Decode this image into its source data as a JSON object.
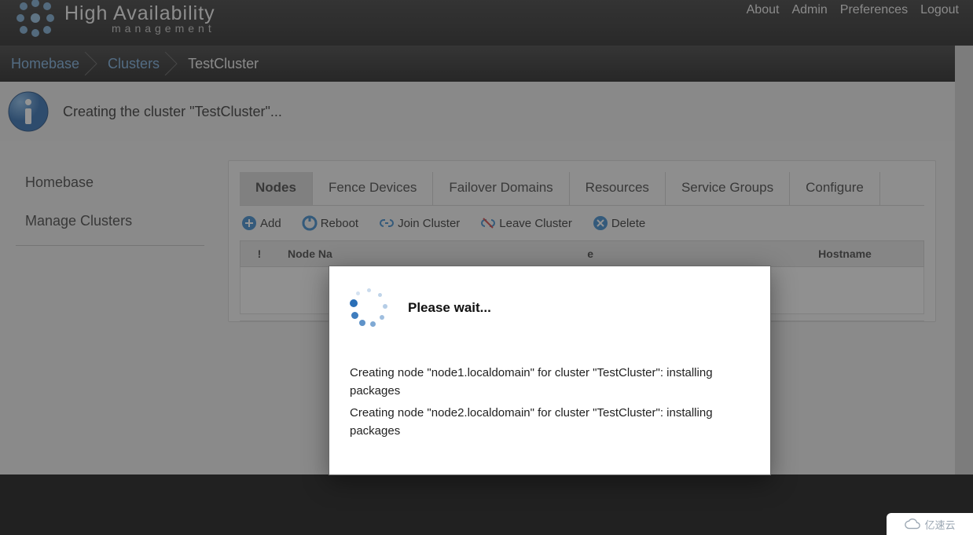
{
  "header": {
    "title_main": "High Availability",
    "title_sub": "management",
    "links": {
      "about": "About",
      "admin": "Admin",
      "preferences": "Preferences",
      "logout": "Logout"
    }
  },
  "breadcrumbs": {
    "home": "Homebase",
    "clusters": "Clusters",
    "current": "TestCluster"
  },
  "info": {
    "message": "Creating the cluster \"TestCluster\"..."
  },
  "sidebar": {
    "home": "Homebase",
    "manage": "Manage Clusters"
  },
  "tabs": {
    "nodes": "Nodes",
    "fence": "Fence Devices",
    "failover": "Failover Domains",
    "resources": "Resources",
    "service_groups": "Service Groups",
    "configure": "Configure"
  },
  "toolbar": {
    "add": "Add",
    "reboot": "Reboot",
    "join": "Join Cluster",
    "leave": "Leave Cluster",
    "delete": "Delete"
  },
  "grid": {
    "bang": "!",
    "node_name": "Node Na",
    "id_col": "e",
    "hostname": "Hostname"
  },
  "modal": {
    "title": "Please wait...",
    "msg1": "Creating node \"node1.localdomain\" for cluster \"TestCluster\": installing packages",
    "msg2": "Creating node \"node2.localdomain\" for cluster \"TestCluster\": installing packages"
  },
  "watermark": {
    "text": "亿速云"
  }
}
